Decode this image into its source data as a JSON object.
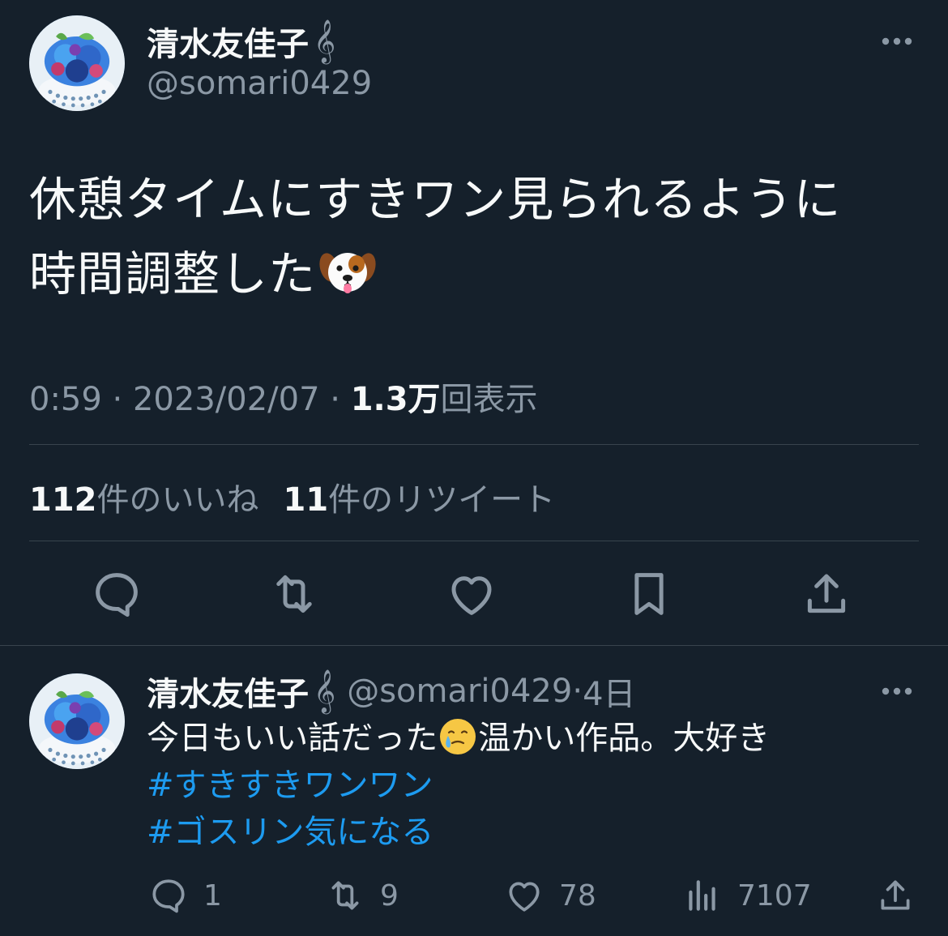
{
  "tweet": {
    "author": {
      "name": "清水友佳子",
      "name_icon": "𝄞",
      "handle": "@somari0429"
    },
    "text_line1": "休憩タイムにすきワン見られるように",
    "text_line2": "時間調整した",
    "emoji": "dog-face-emoji",
    "time": "0:59",
    "date": "2023/02/07",
    "views_count": "1.3万",
    "views_label": "回表示",
    "likes_count": "112",
    "likes_label": "件のいいね",
    "retweets_count": "11",
    "retweets_label": "件のリツイート",
    "actions": [
      "reply-icon",
      "retweet-icon",
      "like-icon",
      "bookmark-icon",
      "share-icon"
    ]
  },
  "reply": {
    "author": {
      "name": "清水友佳子",
      "name_icon": "𝄞",
      "handle": "@somari0429",
      "age": "4日"
    },
    "text_part1": "今日もいい話だった",
    "emoji": "face-holding-back-tears-emoji",
    "text_part2": "温かい作品。大好き",
    "hashtags": [
      "#すきすきワンワン",
      "#ゴスリン気になる"
    ],
    "reply_count": "1",
    "retweet_count": "9",
    "like_count": "78",
    "view_count": "7107"
  },
  "colors": {
    "background": "#15202b",
    "text": "#f7f9f9",
    "secondary_text": "#8b98a5",
    "divider": "#38444d",
    "hashtag": "#1d9bf0"
  }
}
